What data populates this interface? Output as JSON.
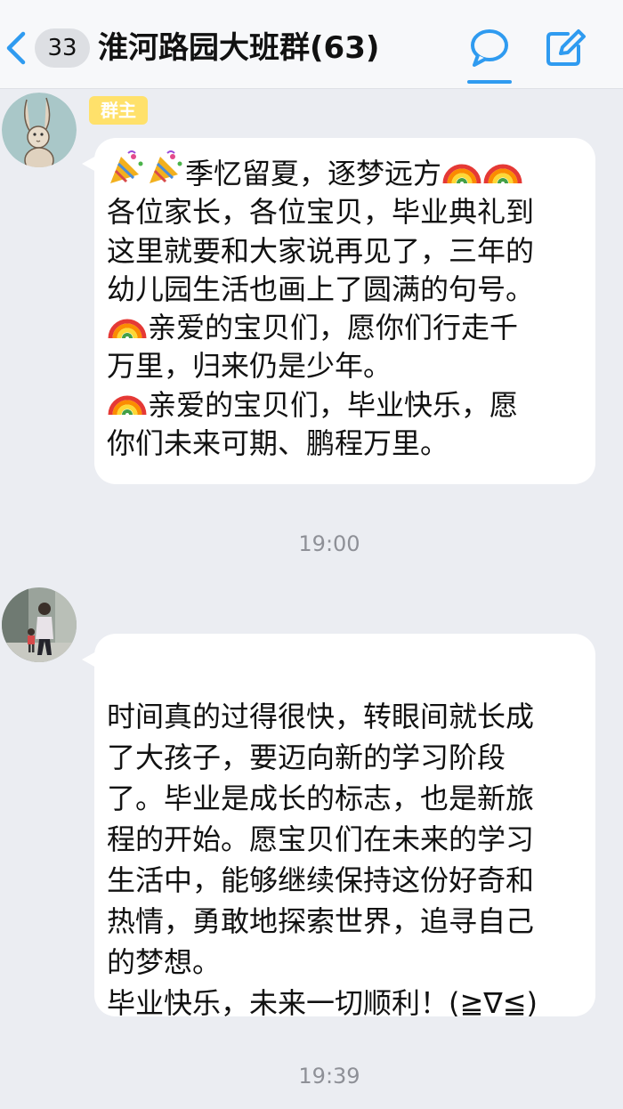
{
  "header": {
    "back_icon": "chevron-left-icon",
    "unread_count": "33",
    "title": "淮河路园大班群(63)",
    "chat_icon": "chat-bubble-icon",
    "edit_icon": "edit-note-icon",
    "accent_color": "#2f9bf0"
  },
  "messages": [
    {
      "sender_badge": "群主",
      "avatar_icon": "rabbit-avatar",
      "segments": [
        {
          "icons": [
            "party-popper-icon",
            "party-popper-icon"
          ],
          "text": "季忆留夏，逐梦远方",
          "icons_after": [
            "rainbow-icon",
            "rainbow-icon"
          ]
        },
        {
          "text": "各位家长，各位宝贝，毕业典礼到"
        },
        {
          "text": "这里就要和大家说再见了，三年的"
        },
        {
          "text": "幼儿园生活也画上了圆满的句号。"
        },
        {
          "icons": [
            "rainbow-icon"
          ],
          "text": "亲爱的宝贝们，愿你们行走千"
        },
        {
          "text": "万里，归来仍是少年。"
        },
        {
          "icons": [
            "rainbow-icon"
          ],
          "text": "亲爱的宝贝们，毕业快乐，愿"
        },
        {
          "text": "你们未来可期、鹏程万里。"
        }
      ]
    },
    {
      "timestamp": "19:00"
    },
    {
      "avatar_icon": "user-photo-avatar",
      "segments": [
        {
          "text": "时间真的过得很快，转眼间就长成"
        },
        {
          "text": "了大孩子，要迈向新的学习阶段"
        },
        {
          "text": "了。毕业是成长的标志，也是新旅"
        },
        {
          "text": "程的开始。愿宝贝们在未来的学习"
        },
        {
          "text": "生活中，能够继续保持这份好奇和"
        },
        {
          "text": "热情，勇敢地探索世界，追寻自己"
        },
        {
          "text": "的梦想。"
        },
        {
          "text": "毕业快乐，未来一切顺利！(≧∇≦)"
        }
      ]
    },
    {
      "timestamp": "19:39"
    }
  ]
}
